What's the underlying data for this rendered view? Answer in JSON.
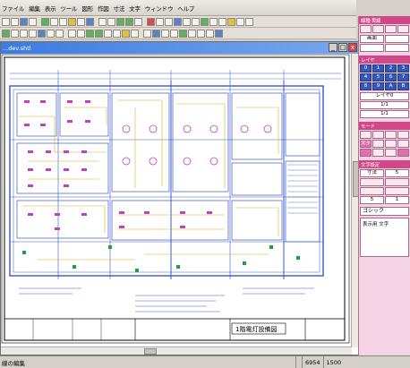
{
  "menu": [
    "ファイル",
    "編集",
    "表示",
    "ツール",
    "図形",
    "作図",
    "寸法",
    "文字",
    "ウィンドウ",
    "ヘルプ"
  ],
  "doc": {
    "title": "...dev.shtl",
    "min": "_",
    "max": "□",
    "close": "x"
  },
  "drawing": {
    "title_block_text": "1階電灯設備図"
  },
  "right_panel": {
    "section1_head": "線種 実線",
    "section1_buttons": [
      "",
      "",
      "",
      "",
      "画面",
      "",
      "",
      ""
    ],
    "section2_head": "レイヤ",
    "section2_buttons": [
      "0",
      "1",
      "2",
      "3",
      "4",
      "5",
      "6",
      "7",
      "8",
      "9",
      "A",
      "B"
    ],
    "scale_labels": [
      "レイヤ0",
      "1/1",
      "1/1"
    ],
    "section3_head": "モード",
    "section3_buttons": [
      "",
      "",
      "",
      "",
      "文字",
      "",
      "",
      "",
      "",
      "",
      "",
      ""
    ],
    "section4_head": "文字設定",
    "section4_buttons": [
      "寸法",
      "5",
      "",
      "",
      "",
      "",
      "5",
      "1"
    ],
    "font": "ゴシック",
    "text_area": "表示用 文字"
  },
  "status": {
    "message": "線の編集",
    "coord1": "6954",
    "coord2": "1500"
  },
  "colors": {
    "title_bar": "#3d7be0",
    "panel_accent": "#d04888",
    "panel_bg": "#f4d4e4",
    "drawing_blue": "#3858c8",
    "drawing_yellow": "#d8b020",
    "drawing_magenta": "#c040c0",
    "drawing_green": "#20a040"
  }
}
